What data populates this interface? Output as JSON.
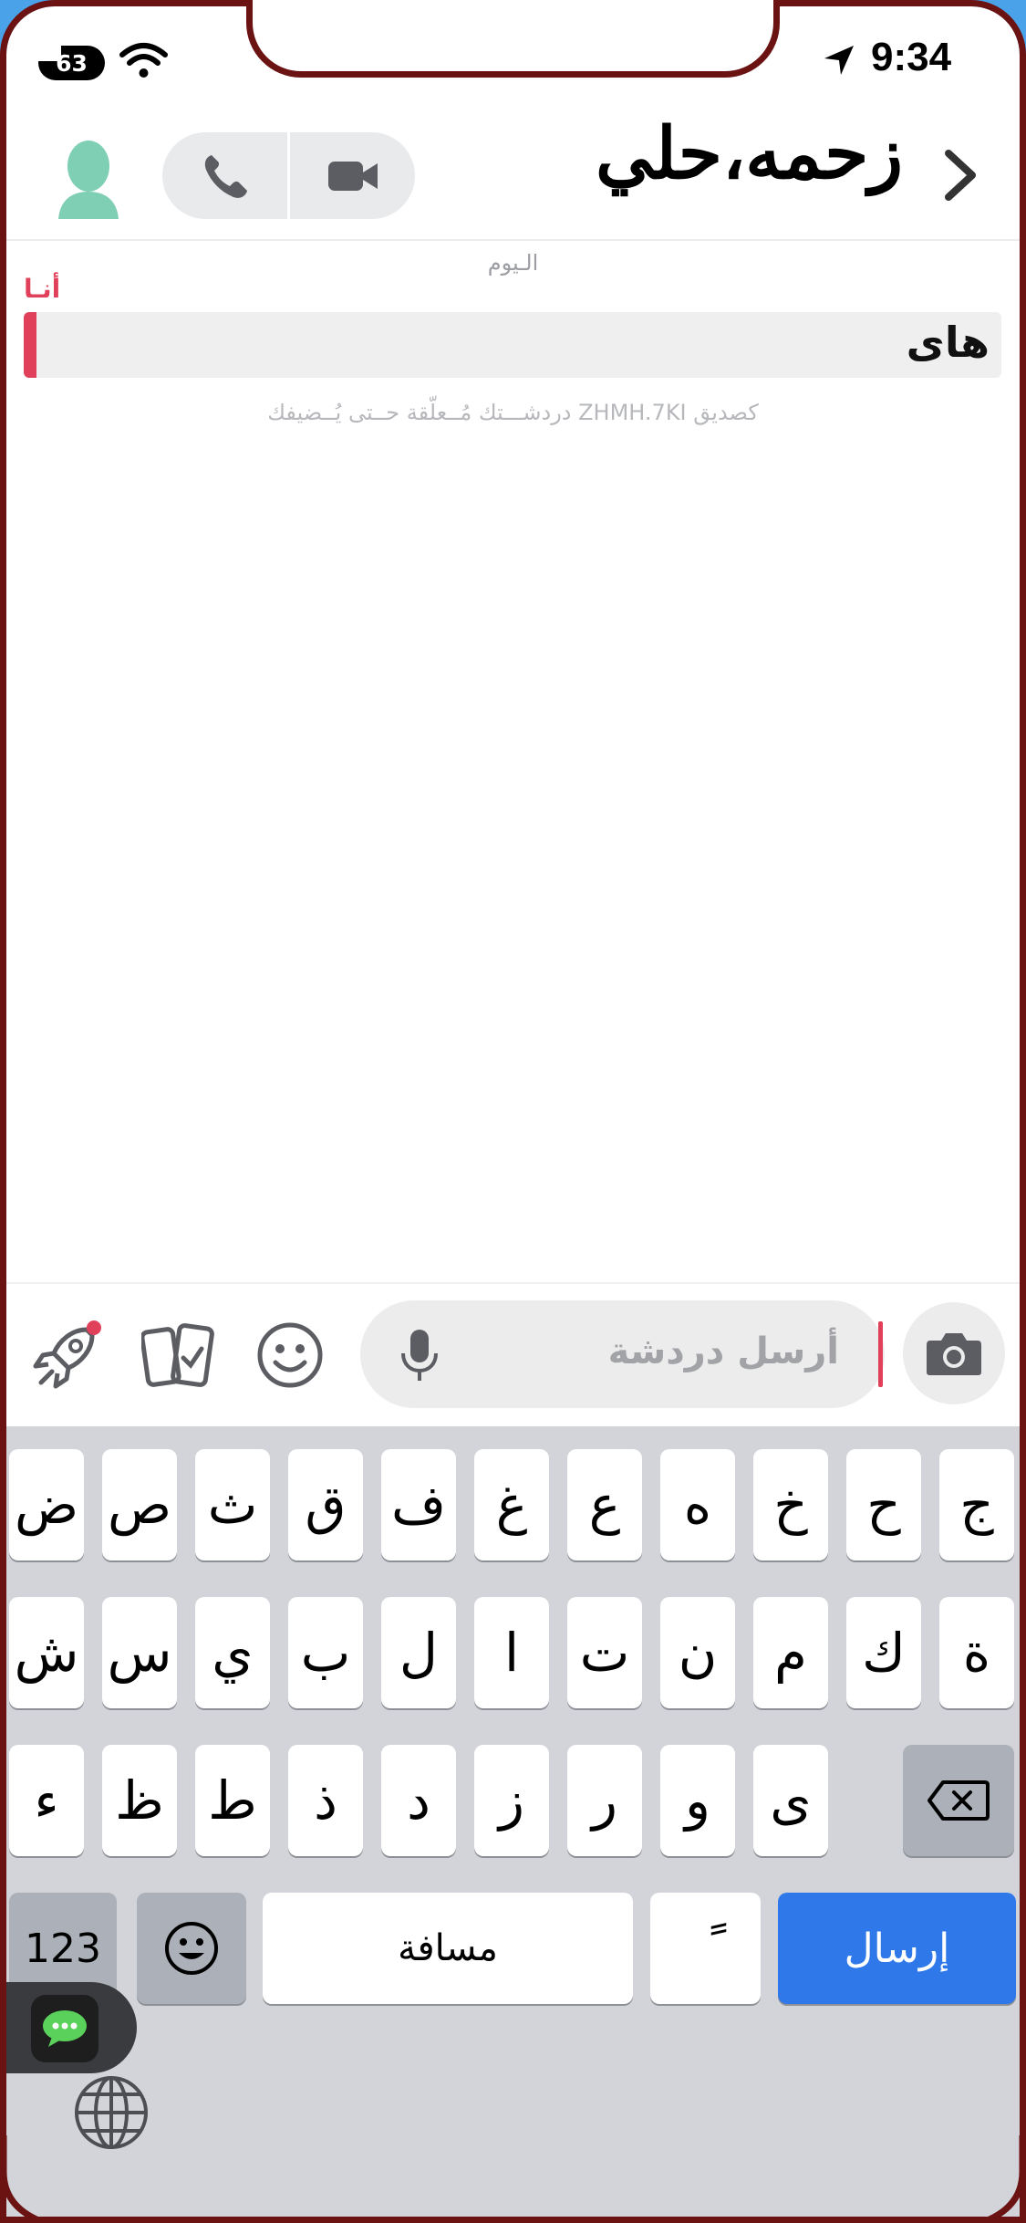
{
  "status_bar": {
    "battery": "63",
    "time": "9:34",
    "icons": [
      "wifi-icon",
      "location-arrow-icon"
    ]
  },
  "header": {
    "title": "زحمه،حلي",
    "back_icon": "chevron-right-icon",
    "call_icon": "phone-icon",
    "video_icon": "video-camera-icon",
    "avatar_icon": "person-avatar-icon"
  },
  "conversation": {
    "day_label": "الـيوم",
    "messages": [
      {
        "sender": "أنـا",
        "text": "هاى"
      }
    ],
    "pending_note": "دردشـــتك مُــعلّقة حــتى يُــضيفك ZHMH.7KI كصديق"
  },
  "composer": {
    "placeholder": "أرسل دردشة",
    "icons": [
      "camera-icon",
      "microphone-icon",
      "emoji-icon",
      "cards-icon",
      "rocket-icon"
    ]
  },
  "keyboard": {
    "row1": [
      "ج",
      "ح",
      "خ",
      "ه",
      "ع",
      "غ",
      "ف",
      "ق",
      "ث",
      "ص",
      "ض"
    ],
    "row2": [
      "ة",
      "ك",
      "م",
      "ن",
      "ت",
      "ا",
      "ل",
      "ب",
      "ي",
      "س",
      "ش"
    ],
    "row3": [
      "ى",
      "و",
      "ر",
      "ز",
      "د",
      "ذ",
      "ط",
      "ظ",
      "ء"
    ],
    "numbers_key": "123",
    "space_key": "مسافة",
    "diacritic_key": "ً",
    "send_key": "إرسال"
  },
  "colors": {
    "accent": "#e0405a",
    "send_blue": "#2f78ea",
    "frame": "#6b1212",
    "avatar": "#7fcfb5"
  }
}
